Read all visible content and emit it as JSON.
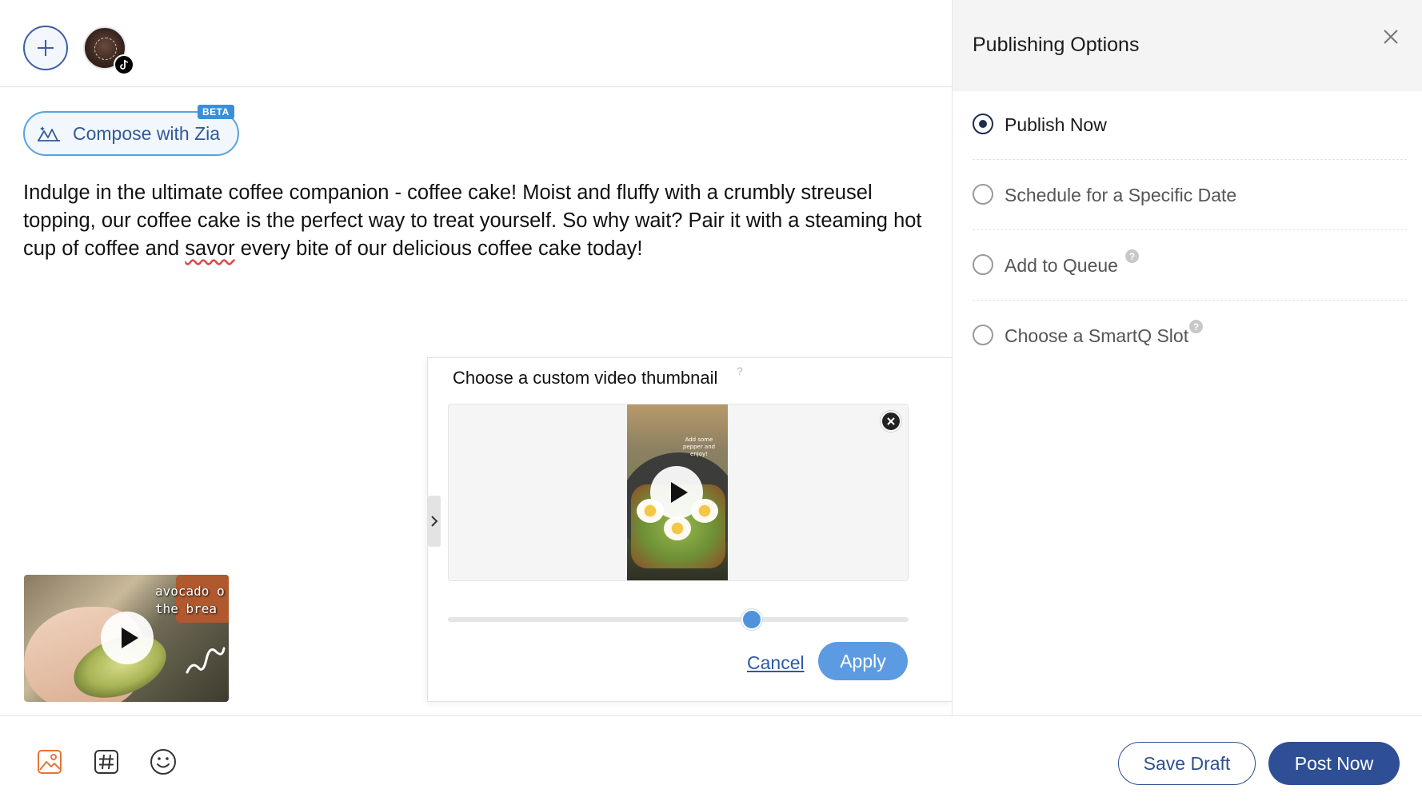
{
  "compose": {
    "zia_label": "Compose with Zia",
    "beta_badge": "BETA",
    "post_text_before": "Indulge in the ultimate coffee companion - coffee cake! Moist and fluffy with a crumbly streusel topping, our coffee cake is the perfect way to treat yourself. So why wait? Pair it with a steaming hot cup of coffee and ",
    "post_text_misspelled": "savor",
    "post_text_after": " every bite of our delicious coffee cake today!",
    "attached_video_overlay_text": "avocado o the brea"
  },
  "thumbnail_chooser": {
    "title": "Choose a custom video thumbnail",
    "help": "?",
    "frame_text": "Add some pepper and enjoy!",
    "slider_position_fraction": 0.66,
    "cancel_label": "Cancel",
    "apply_label": "Apply"
  },
  "toolbar": {
    "icons": [
      "image-icon",
      "hashtag-icon",
      "emoji-icon"
    ],
    "save_draft_label": "Save Draft",
    "post_now_label": "Post Now"
  },
  "publishing_panel": {
    "title": "Publishing Options",
    "options": [
      {
        "label": "Publish Now",
        "selected": true,
        "help": false
      },
      {
        "label": "Schedule for a Specific Date",
        "selected": false,
        "help": false
      },
      {
        "label": "Add to Queue",
        "selected": false,
        "help": true
      },
      {
        "label": "Choose a SmartQ Slot",
        "selected": false,
        "help": true
      }
    ],
    "help_glyph": "?"
  },
  "colors": {
    "primary": "#2e4f95",
    "accent_blue": "#5c9be2",
    "zia_border": "#5aa3d8",
    "image_icon": "#e8743b"
  }
}
